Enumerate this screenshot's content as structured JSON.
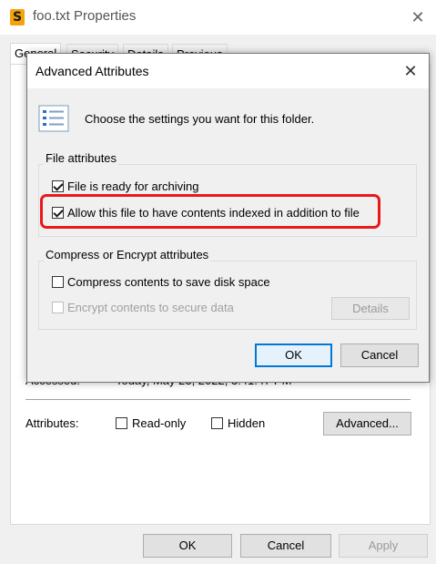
{
  "outer_window": {
    "app_icon_glyph": "S",
    "title": "foo.txt Properties",
    "close_glyph": "✕",
    "tabs": [
      "General",
      "Security",
      "Details",
      "Previous Versions"
    ],
    "accessed_label": "Accessed:",
    "accessed_value": "Today, May 23, 2022, 3:41:47 PM",
    "attributes_label": "Attributes:",
    "readonly_label": "Read-only",
    "readonly_checked": false,
    "hidden_label": "Hidden",
    "hidden_checked": false,
    "advanced_button": "Advanced...",
    "ok_button": "OK",
    "cancel_button": "Cancel",
    "apply_button": "Apply"
  },
  "dialog": {
    "title": "Advanced Attributes",
    "close_glyph": "✕",
    "intro_text": "Choose the settings you want for this folder.",
    "file_attributes_group": "File attributes",
    "archive_label": "File is ready for archiving",
    "archive_checked": true,
    "index_label": "Allow this file to have contents indexed in addition to file",
    "index_checked": true,
    "compress_group": "Compress or Encrypt attributes",
    "compress_label": "Compress contents to save disk space",
    "compress_checked": false,
    "encrypt_label": "Encrypt contents to secure data",
    "encrypt_checked": false,
    "details_button": "Details",
    "ok_button": "OK",
    "cancel_button": "Cancel"
  },
  "colors": {
    "highlight": "#e8191b",
    "default_button_border": "#0078d7",
    "app_icon": "#f4a30b"
  }
}
